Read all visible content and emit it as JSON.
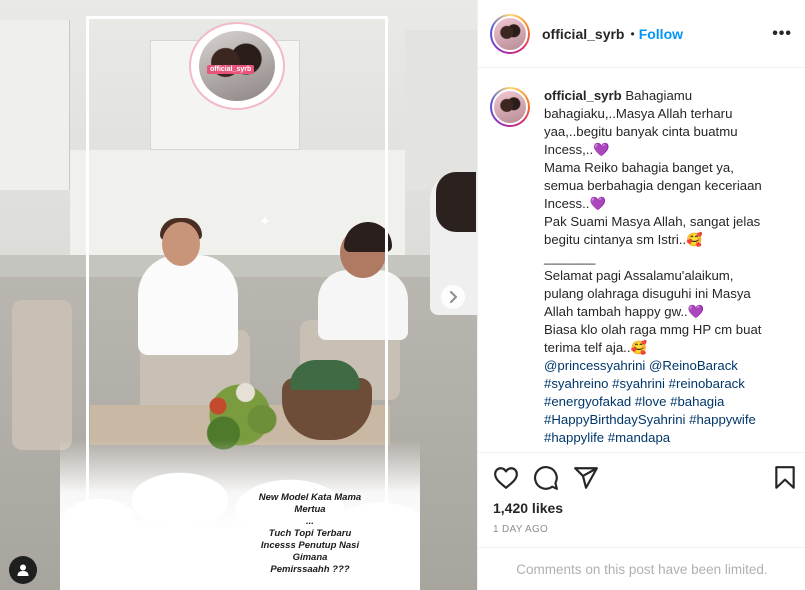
{
  "post": {
    "username": "official_syrb",
    "follow_label": "Follow",
    "separator": "•",
    "more_label": "•••",
    "badge_label": "official_syrb",
    "overlay_text": [
      "New Model Kata Mama",
      "Mertua",
      "...",
      "Tuch Topi Terbaru",
      "Incesss Penutup Nasi",
      "Gimana",
      "Pemirssaahh ???"
    ],
    "caption_username": "official_syrb",
    "caption_lines": [
      "Bahagiamu",
      "bahagiaku,..Masya Allah terharu",
      "yaa,..begitu banyak cinta buatmu",
      "Incess,..💜",
      "Mama Reiko bahagia banget ya,",
      "semua berbahagia dengan keceriaan",
      "Incess..💜",
      "Pak Suami Masya Allah, sangat jelas",
      "begitu cintanya sm Istri..🥰",
      "_______",
      "Selamat pagi Assalamu'alaikum,",
      "pulang olahraga disuguhi ini Masya",
      "Allah tambah happy gw..💜",
      "Biasa klo olah raga mmg HP cm buat",
      "terima telf aja..🥰"
    ],
    "tag_lines": [
      "@princessyahrini @ReinoBarack",
      "#syahreino #syahrini #reinobarack",
      "#energyofakad #love #bahagia",
      "#HappyBirthdaySyahrini #happywife",
      "#happylife #mandapa"
    ],
    "likes": "1,420 likes",
    "timestamp": "1 DAY AGO",
    "comments_limited": "Comments on this post have been limited."
  },
  "icons": {
    "like": "heart-icon",
    "comment": "comment-icon",
    "share": "paper-plane-icon",
    "save": "bookmark-icon",
    "next": "chevron-right-icon",
    "tag": "user-tag-icon"
  }
}
